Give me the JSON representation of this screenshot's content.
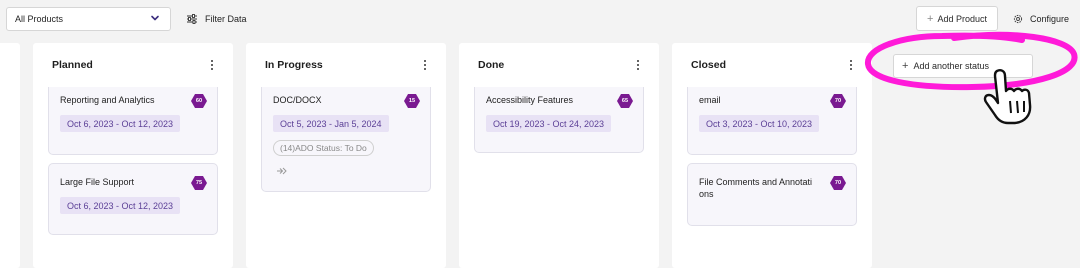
{
  "toolbar": {
    "product_select": {
      "value": "All Products",
      "icon": "chevron-down-icon"
    },
    "filter": {
      "label": "Filter Data",
      "icon": "sliders-icon"
    },
    "add_product": {
      "label": "Add Product",
      "icon": "plus-icon"
    },
    "configure": {
      "label": "Configure",
      "icon": "gear-icon"
    }
  },
  "columns": [
    {
      "title": "Planned",
      "cards": [
        {
          "title": "Reporting and Analytics",
          "badge": "60",
          "dates": "Oct 6, 2023 - Oct 12, 2023"
        },
        {
          "title": "Large File Support",
          "badge": "75",
          "dates": "Oct 6, 2023 - Oct 12, 2023"
        }
      ]
    },
    {
      "title": "In Progress",
      "cards": [
        {
          "title": "DOC/DOCX",
          "badge": "15",
          "dates": "Oct 5, 2023 - Jan 5, 2024",
          "ado_status": "(14)ADO Status: To Do",
          "link_icon": "link-icon"
        }
      ]
    },
    {
      "title": "Done",
      "cards": [
        {
          "title": "Accessibility Features",
          "badge": "65",
          "dates": "Oct 19, 2023 - Oct 24, 2023"
        }
      ]
    },
    {
      "title": "Closed",
      "cards": [
        {
          "title": "email",
          "badge": "70",
          "dates": "Oct 3, 2023 - Oct 10, 2023"
        },
        {
          "title_lines": [
            "File Comments and Annotati",
            "ons"
          ],
          "badge": "70"
        }
      ]
    }
  ],
  "add_status": {
    "label": "Add another status",
    "icon": "plus-icon"
  },
  "annotation": {
    "ring_color": "#ff1ad9",
    "cursor": "hand-pointer-icon"
  },
  "colors": {
    "badge": "#7a1a91",
    "date_chip_bg": "#e8e2f5",
    "date_chip_text": "#5b3f96",
    "board_bg": "#f3f3f3"
  }
}
